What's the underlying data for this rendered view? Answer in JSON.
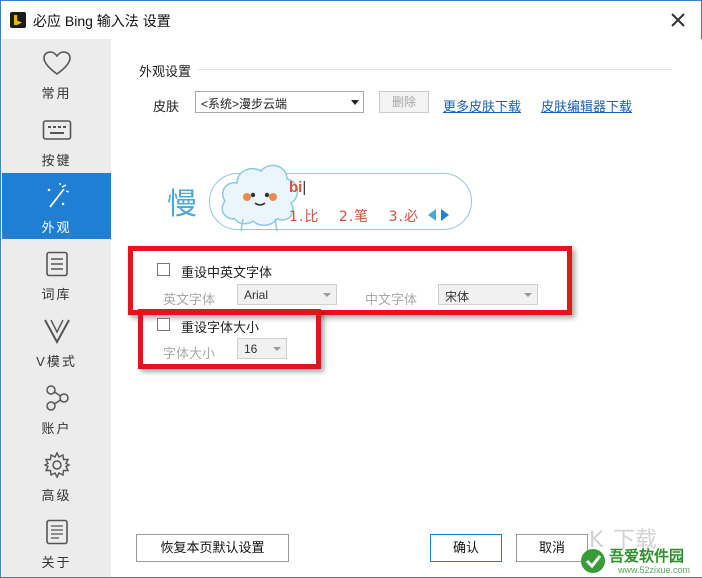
{
  "window": {
    "title": "必应 Bing 输入法 设置",
    "close_icon": "close-icon"
  },
  "sidebar": {
    "items": [
      {
        "label": "常用",
        "icon": "heart-icon",
        "active": false
      },
      {
        "label": "按键",
        "icon": "keyboard-icon",
        "active": false
      },
      {
        "label": "外观",
        "icon": "magic-wand-icon",
        "active": true
      },
      {
        "label": "词库",
        "icon": "document-icon",
        "active": false
      },
      {
        "label": "V模式",
        "icon": "v-letter-icon",
        "active": false
      },
      {
        "label": "账户",
        "icon": "share-nodes-icon",
        "active": false
      },
      {
        "label": "高级",
        "icon": "gear-icon",
        "active": false
      },
      {
        "label": "关于",
        "icon": "info-document-icon",
        "active": false
      }
    ]
  },
  "appearance": {
    "section_title": "外观设置",
    "skin_label": "皮肤",
    "skin_value": "<系统>漫步云端",
    "delete_label": "删除",
    "more_skins_link": "更多皮肤下载",
    "skin_editor_link": "皮肤编辑器下载",
    "preview": {
      "typed_char": "慢",
      "pinyin": "bi",
      "candidates": [
        "1.比",
        "2.笔",
        "3.必"
      ]
    }
  },
  "font_reset": {
    "checkbox_label": "重设中英文字体",
    "checked": false,
    "english_font_label": "英文字体",
    "english_font_value": "Arial",
    "chinese_font_label": "中文字体",
    "chinese_font_value": "宋体"
  },
  "size_reset": {
    "checkbox_label": "重设字体大小",
    "checked": false,
    "size_label": "字体大小",
    "size_value": "16"
  },
  "footer": {
    "restore_label": "恢复本页默认设置",
    "ok_label": "确认",
    "cancel_label": "取消"
  },
  "watermark": {
    "text": "吾爱软件园",
    "url": "www.52zixue.com"
  },
  "colors": {
    "accent": "#1f7fd3",
    "highlight_box": "#e3151c",
    "link": "#1a5fb4"
  }
}
